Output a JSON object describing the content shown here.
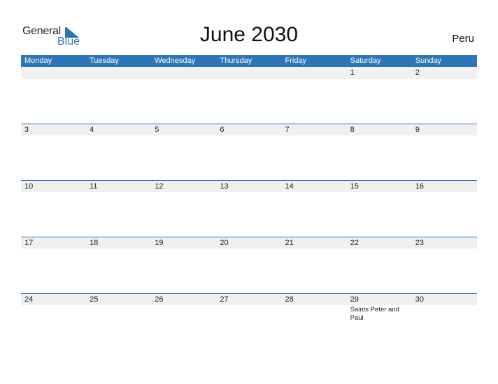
{
  "logo": {
    "general": "General",
    "blue": "Blue"
  },
  "title": "June 2030",
  "country": "Peru",
  "colors": {
    "accent": "#2e75b6",
    "row_bg": "#f0f0f0"
  },
  "weekdays": [
    "Monday",
    "Tuesday",
    "Wednesday",
    "Thursday",
    "Friday",
    "Saturday",
    "Sunday"
  ],
  "weeks": [
    {
      "days": [
        "",
        "",
        "",
        "",
        "",
        "1",
        "2"
      ],
      "events": [
        "",
        "",
        "",
        "",
        "",
        "",
        ""
      ]
    },
    {
      "days": [
        "3",
        "4",
        "5",
        "6",
        "7",
        "8",
        "9"
      ],
      "events": [
        "",
        "",
        "",
        "",
        "",
        "",
        ""
      ]
    },
    {
      "days": [
        "10",
        "11",
        "12",
        "13",
        "14",
        "15",
        "16"
      ],
      "events": [
        "",
        "",
        "",
        "",
        "",
        "",
        ""
      ]
    },
    {
      "days": [
        "17",
        "18",
        "19",
        "20",
        "21",
        "22",
        "23"
      ],
      "events": [
        "",
        "",
        "",
        "",
        "",
        "",
        ""
      ]
    },
    {
      "days": [
        "24",
        "25",
        "26",
        "27",
        "28",
        "29",
        "30"
      ],
      "events": [
        "",
        "",
        "",
        "",
        "",
        "Saints Peter and Paul",
        ""
      ]
    }
  ]
}
